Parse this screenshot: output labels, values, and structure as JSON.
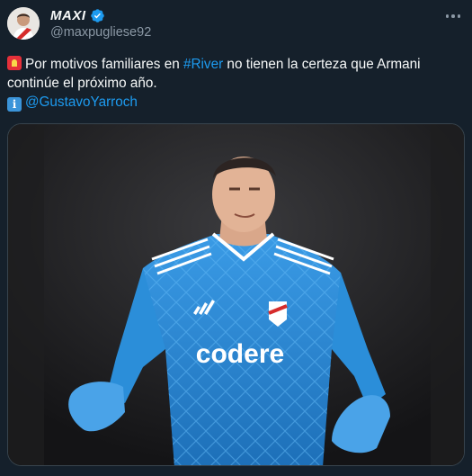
{
  "author": {
    "display_name": "MAXI",
    "handle": "@maxpugliese92",
    "verified": true
  },
  "tweet": {
    "line1_before": "Por motivos familiares en ",
    "hashtag": "#River",
    "line1_after": " no tienen la certeza que Armani continúe el próximo año.",
    "mention": "@GustavoYarroch"
  },
  "media": {
    "jersey_sponsor": "codere"
  },
  "icons": {
    "line1": "police-siren-icon",
    "line2": "information-icon",
    "menu": "more-options-icon"
  },
  "colors": {
    "background": "#15202b",
    "link": "#1d9bf0",
    "muted": "#8b98a5",
    "jersey": "#2b8ed9"
  }
}
